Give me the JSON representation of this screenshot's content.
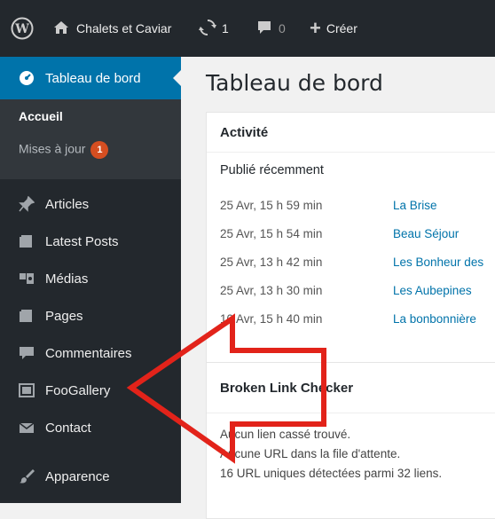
{
  "topbar": {
    "site_name": "Chalets et Caviar",
    "updates_count": "1",
    "comments_count": "0",
    "new_label": "Créer"
  },
  "sidebar": {
    "active": "Tableau de bord",
    "submenu": {
      "home": "Accueil",
      "updates": "Mises à jour",
      "updates_badge": "1"
    },
    "items": [
      {
        "label": "Articles",
        "icon": "pin-icon"
      },
      {
        "label": "Latest Posts",
        "icon": "posts-icon"
      },
      {
        "label": "Médias",
        "icon": "media-icon"
      },
      {
        "label": "Pages",
        "icon": "page-icon"
      },
      {
        "label": "Commentaires",
        "icon": "comment-icon"
      },
      {
        "label": "FooGallery",
        "icon": "gallery-icon"
      },
      {
        "label": "Contact",
        "icon": "mail-icon"
      },
      {
        "label": "Apparence",
        "icon": "brush-icon"
      }
    ]
  },
  "main": {
    "title": "Tableau de bord",
    "activity": {
      "title": "Activité",
      "subtitle": "Publié récemment",
      "rows": [
        {
          "date": "25 Avr, 15 h 59 min",
          "link": "La Brise"
        },
        {
          "date": "25 Avr, 15 h 54 min",
          "link": "Beau Séjour"
        },
        {
          "date": "25 Avr, 13 h 42 min",
          "link": "Les Bonheur des"
        },
        {
          "date": "25 Avr, 13 h 30 min",
          "link": "Les Aubepines"
        },
        {
          "date": "10 Avr, 15 h 40 min",
          "link": "La bonbonnière"
        }
      ]
    },
    "blc": {
      "title": "Broken Link Checker",
      "lines": [
        "Aucun lien cassé trouvé.",
        "Aucune URL dans la file d'attente.",
        "16 URL uniques détectées parmi 32 liens."
      ]
    }
  },
  "colors": {
    "admin_bar": "#23282d",
    "active": "#0073aa",
    "link": "#0073aa",
    "badge": "#d54e21",
    "arrow": "#e2231a"
  }
}
